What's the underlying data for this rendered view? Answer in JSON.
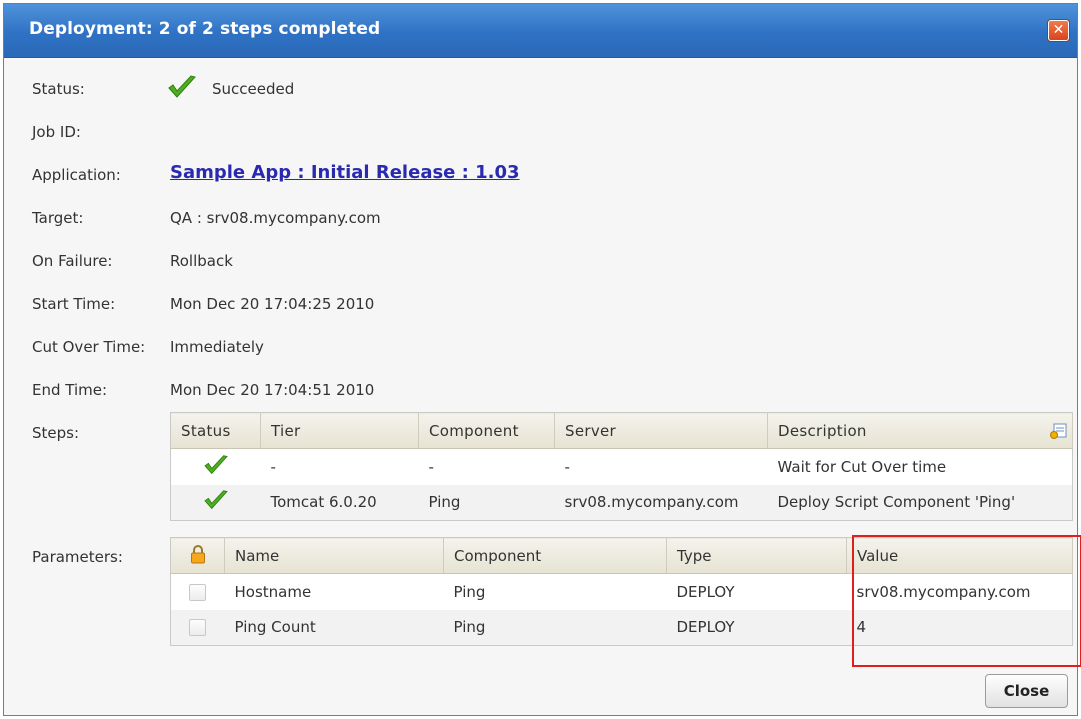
{
  "window": {
    "title": "Deployment: 2 of 2 steps completed",
    "close_icon": "close-icon",
    "accent": "#2f72c4"
  },
  "fields": {
    "status_label": "Status:",
    "status_value": "Succeeded",
    "job_id_label": "Job ID:",
    "job_id_value": "",
    "application_label": "Application:",
    "application_value": "Sample App : Initial Release : 1.03",
    "target_label": "Target:",
    "target_value": "QA : srv08.mycompany.com",
    "on_failure_label": "On Failure:",
    "on_failure_value": "Rollback",
    "start_time_label": "Start Time:",
    "start_time_value": "Mon Dec 20 17:04:25 2010",
    "cut_over_label": "Cut Over Time:",
    "cut_over_value": "Immediately",
    "end_time_label": "End Time:",
    "end_time_value": "Mon Dec 20 17:04:51 2010",
    "steps_label": "Steps:",
    "parameters_label": "Parameters:"
  },
  "steps": {
    "columns": [
      "Status",
      "Tier",
      "Component",
      "Server",
      "Description"
    ],
    "rows": [
      {
        "status": "check-icon",
        "tier": "-",
        "component": "-",
        "server": "-",
        "description": "Wait for Cut Over time"
      },
      {
        "status": "check-icon",
        "tier": "Tomcat 6.0.20",
        "component": "Ping",
        "server": "srv08.mycompany.com",
        "description": "Deploy Script Component 'Ping'"
      }
    ]
  },
  "parameters": {
    "lock_icon": "lock-icon",
    "columns": [
      "Name",
      "Component",
      "Type",
      "Value"
    ],
    "rows": [
      {
        "name": "Hostname",
        "component": "Ping",
        "type": "DEPLOY",
        "value": "srv08.mycompany.com"
      },
      {
        "name": "Ping Count",
        "component": "Ping",
        "type": "DEPLOY",
        "value": "4"
      }
    ]
  },
  "buttons": {
    "close_label": "Close"
  },
  "colors": {
    "highlight": "#e11e1e",
    "check": "#4caf1f",
    "link": "#2a2ab0"
  }
}
